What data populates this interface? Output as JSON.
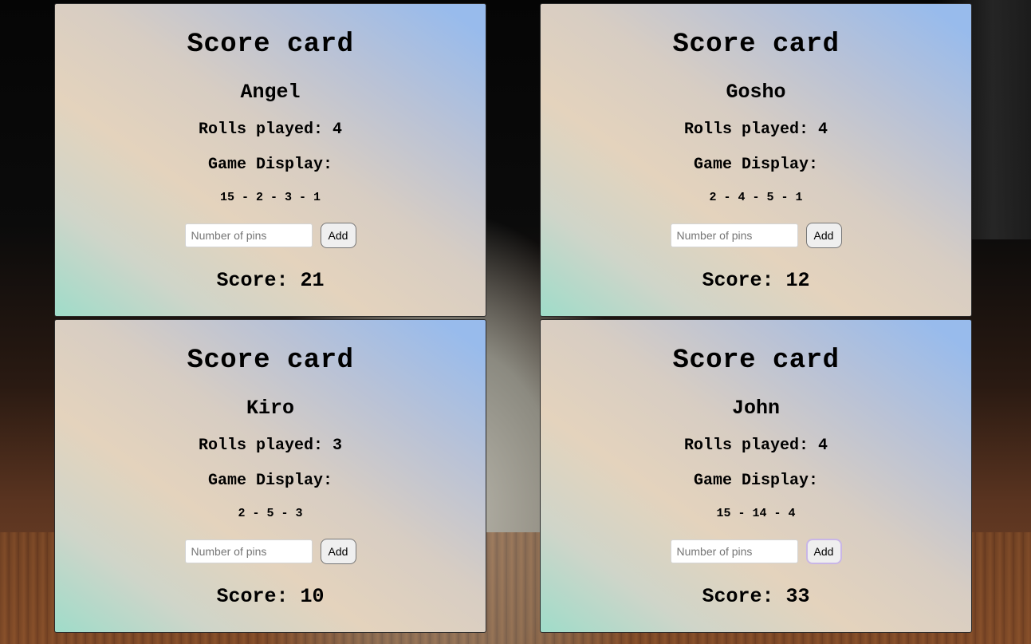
{
  "cards": [
    {
      "heading": "Score card",
      "player": "Angel",
      "rolls_label": "Rolls played:",
      "rolls": "4",
      "display_label": "Game Display:",
      "display": "15 - 2 - 3 - 1",
      "input_placeholder": "Number of pins",
      "add_label": "Add",
      "score_label": "Score:",
      "score": "21"
    },
    {
      "heading": "Score card",
      "player": "Gosho",
      "rolls_label": "Rolls played:",
      "rolls": "4",
      "display_label": "Game Display:",
      "display": "2 - 4 - 5 - 1",
      "input_placeholder": "Number of pins",
      "add_label": "Add",
      "score_label": "Score:",
      "score": "12"
    },
    {
      "heading": "Score card",
      "player": "Kiro",
      "rolls_label": "Rolls played:",
      "rolls": "3",
      "display_label": "Game Display:",
      "display": "2 - 5 - 3",
      "input_placeholder": "Number of pins",
      "add_label": "Add",
      "score_label": "Score:",
      "score": "10"
    },
    {
      "heading": "Score card",
      "player": "John",
      "rolls_label": "Rolls played:",
      "rolls": "4",
      "display_label": "Game Display:",
      "display": "15 - 14 - 4",
      "input_placeholder": "Number of pins",
      "add_label": "Add",
      "score_label": "Score:",
      "score": "33"
    }
  ]
}
